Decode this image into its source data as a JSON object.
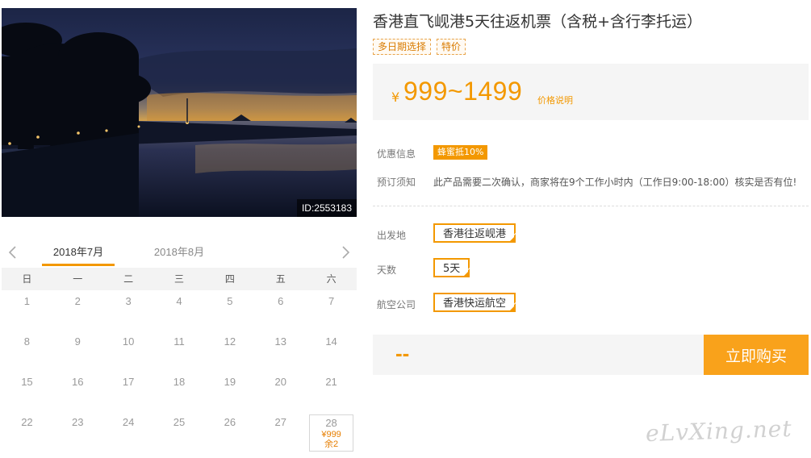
{
  "hero": {
    "image_desc": "",
    "id_badge": "ID:2553183"
  },
  "calendar": {
    "tabs": [
      "2018年7月",
      "2018年8月"
    ],
    "weekdays": [
      "日",
      "一",
      "二",
      "三",
      "四",
      "五",
      "六"
    ],
    "days": [
      {
        "d": "1"
      },
      {
        "d": "2"
      },
      {
        "d": "3"
      },
      {
        "d": "4"
      },
      {
        "d": "5"
      },
      {
        "d": "6"
      },
      {
        "d": "7"
      },
      {
        "d": "8"
      },
      {
        "d": "9"
      },
      {
        "d": "10"
      },
      {
        "d": "11"
      },
      {
        "d": "12"
      },
      {
        "d": "13"
      },
      {
        "d": "14"
      },
      {
        "d": "15"
      },
      {
        "d": "16"
      },
      {
        "d": "17"
      },
      {
        "d": "18"
      },
      {
        "d": "19"
      },
      {
        "d": "20"
      },
      {
        "d": "21"
      },
      {
        "d": "22"
      },
      {
        "d": "23"
      },
      {
        "d": "24"
      },
      {
        "d": "25"
      },
      {
        "d": "26"
      },
      {
        "d": "27"
      },
      {
        "d": "28",
        "price": "¥999",
        "stock": "余2"
      }
    ]
  },
  "product": {
    "title": "香港直飞岘港5天往返机票（含税+含行李托运）",
    "tags": [
      "多日期选择",
      "特价"
    ]
  },
  "price": {
    "currency": "¥",
    "range": "999~1499",
    "note": "价格说明"
  },
  "info": {
    "promo_label": "优惠信息",
    "promo_badge": "蜂蜜抵10%",
    "notice_label": "预订须知",
    "notice_text": "此产品需要二次确认，商家将在9个工作小时内（工作日9:00-18:00）核实是否有位!"
  },
  "options": {
    "departure_label": "出发地",
    "departure_value": "香港往返岘港",
    "days_label": "天数",
    "days_value": "5天",
    "airline_label": "航空公司",
    "airline_value": "香港快运航空"
  },
  "purchase": {
    "total": "--",
    "button_label": "立即购买"
  },
  "watermark": "eLvXing.net",
  "colors": {
    "accent": "#f39800",
    "button": "#f9a21b"
  }
}
